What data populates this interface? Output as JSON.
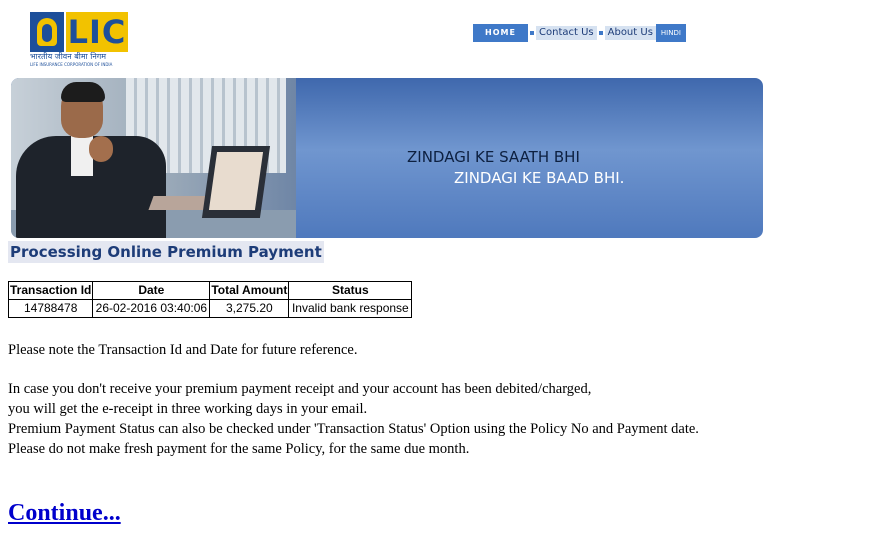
{
  "header": {
    "logo": {
      "word": "LIC",
      "hindi_name": "भारतीय जीवन बीमा निगम",
      "english_name": "LIFE INSURANCE CORPORATION OF INDIA",
      "icon": "lic-emblem-icon"
    },
    "nav": {
      "home": "HOME",
      "contact": "Contact Us",
      "about": "About Us",
      "hindi": "HINDI"
    }
  },
  "banner": {
    "line1": "ZINDAGI KE SAATH BHI",
    "line2": "ZINDAGI KE BAAD BHI."
  },
  "main": {
    "title": "Processing Online Premium Payment",
    "table": {
      "headers": [
        "Transaction Id",
        "Date",
        "Total Amount",
        "Status"
      ],
      "row": [
        "14788478",
        "26-02-2016 03:40:06",
        "3,275.20",
        "Invalid bank response"
      ]
    },
    "note": "Please note the Transaction Id and Date for future reference.",
    "info_lines": [
      "In case you don't receive your premium payment receipt and your account has been debited/charged,",
      "you will get the e-receipt in three working days in your email.",
      "Premium Payment Status can also be checked under 'Transaction Status' Option using the Policy No and Payment date.",
      "Please do not make fresh payment for the same Policy, for the same due month."
    ],
    "continue_link": "Continue..."
  },
  "colors": {
    "brand_blue": "#1d4f9a",
    "brand_yellow": "#f2c200",
    "nav_blue": "#3f79c8",
    "link": "#0000cc"
  }
}
